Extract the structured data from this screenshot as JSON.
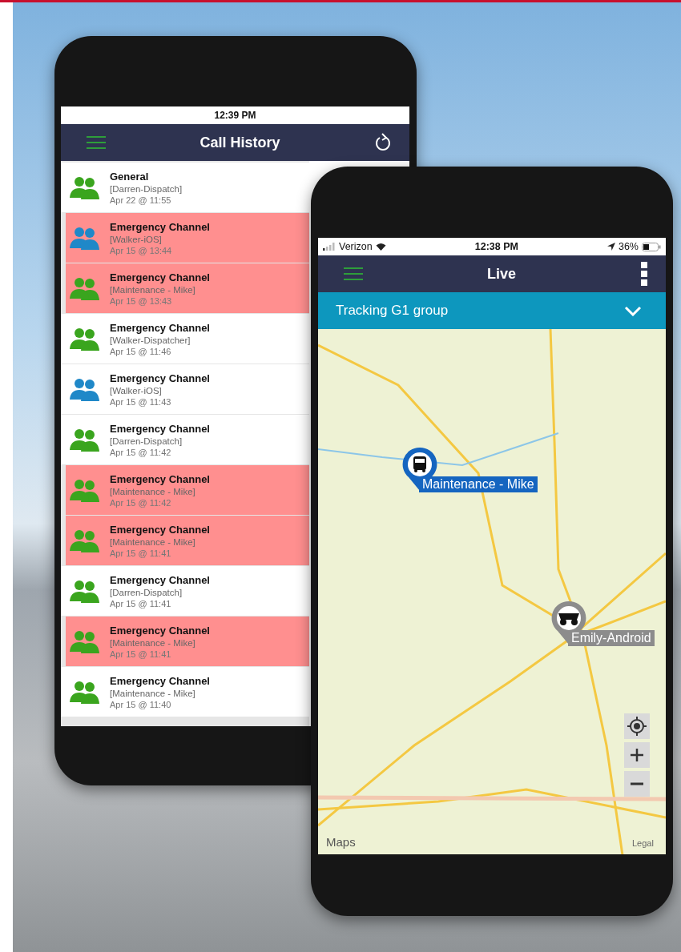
{
  "call_history": {
    "status_time": "12:39 PM",
    "title": "Call History",
    "rows": [
      {
        "channel": "General",
        "caller": "[Darren-Dispatch]",
        "time": "Apr 22 @ 11:55",
        "color": "#3aa51e",
        "highlighted": false
      },
      {
        "channel": "Emergency Channel",
        "caller": "[Walker-iOS]",
        "time": "Apr 15 @ 13:44",
        "color": "#1f88c8",
        "highlighted": true
      },
      {
        "channel": "Emergency Channel",
        "caller": "[Maintenance - Mike]",
        "time": "Apr 15 @ 13:43",
        "color": "#3aa51e",
        "highlighted": true
      },
      {
        "channel": "Emergency Channel",
        "caller": "[Walker-Dispatcher]",
        "time": "Apr 15 @ 11:46",
        "color": "#3aa51e",
        "highlighted": false
      },
      {
        "channel": "Emergency Channel",
        "caller": "[Walker-iOS]",
        "time": "Apr 15 @ 11:43",
        "color": "#1f88c8",
        "highlighted": false
      },
      {
        "channel": "Emergency Channel",
        "caller": "[Darren-Dispatch]",
        "time": "Apr 15 @ 11:42",
        "color": "#3aa51e",
        "highlighted": false
      },
      {
        "channel": "Emergency Channel",
        "caller": "[Maintenance - Mike]",
        "time": "Apr 15 @ 11:42",
        "color": "#3aa51e",
        "highlighted": true
      },
      {
        "channel": "Emergency Channel",
        "caller": "[Maintenance - Mike]",
        "time": "Apr 15 @ 11:41",
        "color": "#3aa51e",
        "highlighted": true
      },
      {
        "channel": "Emergency Channel",
        "caller": "[Darren-Dispatch]",
        "time": "Apr 15 @ 11:41",
        "color": "#3aa51e",
        "highlighted": false
      },
      {
        "channel": "Emergency Channel",
        "caller": "[Maintenance - Mike]",
        "time": "Apr 15 @ 11:41",
        "color": "#3aa51e",
        "highlighted": true
      },
      {
        "channel": "Emergency Channel",
        "caller": "[Maintenance - Mike]",
        "time": "Apr 15 @ 11:40",
        "color": "#3aa51e",
        "highlighted": false
      }
    ]
  },
  "live": {
    "status_bar": {
      "carrier": "Verizon",
      "time": "12:38 PM",
      "battery": "36%"
    },
    "title": "Live",
    "group_selector": "Tracking G1 group",
    "map": {
      "markers": [
        {
          "label": "Maintenance - Mike",
          "kind": "bus",
          "color": "#1565c0"
        },
        {
          "label": "Emily-Android",
          "kind": "truck",
          "color": "#8c8c8c"
        }
      ],
      "attribution": "Maps",
      "legal": "Legal"
    }
  }
}
